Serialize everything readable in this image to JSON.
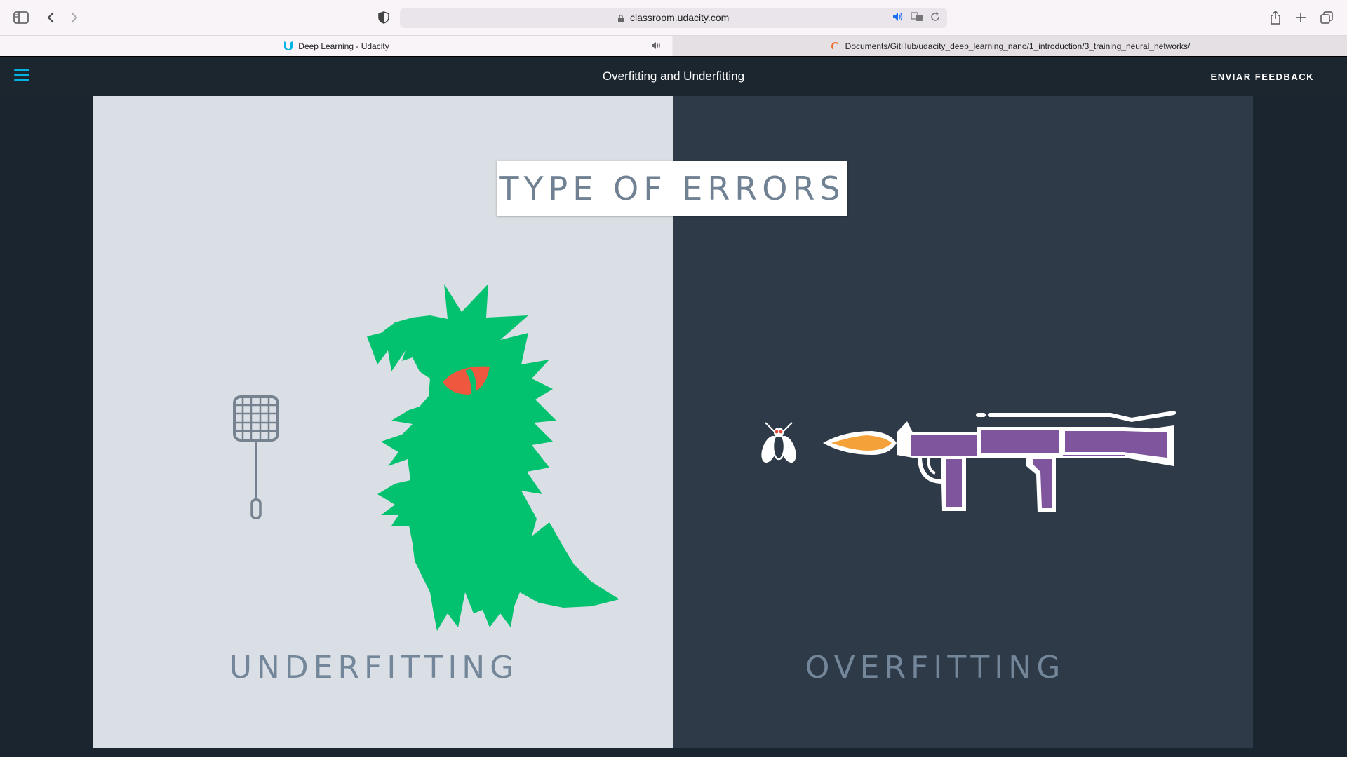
{
  "browser": {
    "url": "classroom.udacity.com",
    "tabs": [
      {
        "label": "Deep Learning - Udacity"
      },
      {
        "label": "Documents/GitHub/udacity_deep_learning_nano/1_introduction/3_training_neural_networks/"
      }
    ]
  },
  "header": {
    "title": "Overfitting and Underfitting",
    "feedback_label": "ENVIAR FEEDBACK"
  },
  "slide": {
    "title": "TYPE OF ERRORS",
    "left_label": "UNDERFITTING",
    "right_label": "OVERFITTING"
  },
  "colors": {
    "accent": "#02b3e4",
    "monster": "#02c26f",
    "monster_eye": "#f0573f",
    "rocket": "#7f559e",
    "flame": "#f4a13a",
    "left_bg": "#d9dfe4",
    "right_bg": "#2e3a47"
  },
  "icons": [
    "sidebar-icon",
    "back-icon",
    "forward-icon",
    "shield-icon",
    "lock-icon",
    "audio-icon",
    "translate-icon",
    "reload-icon",
    "share-icon",
    "new-tab-icon",
    "tabs-overview-icon",
    "hamburger-icon"
  ]
}
